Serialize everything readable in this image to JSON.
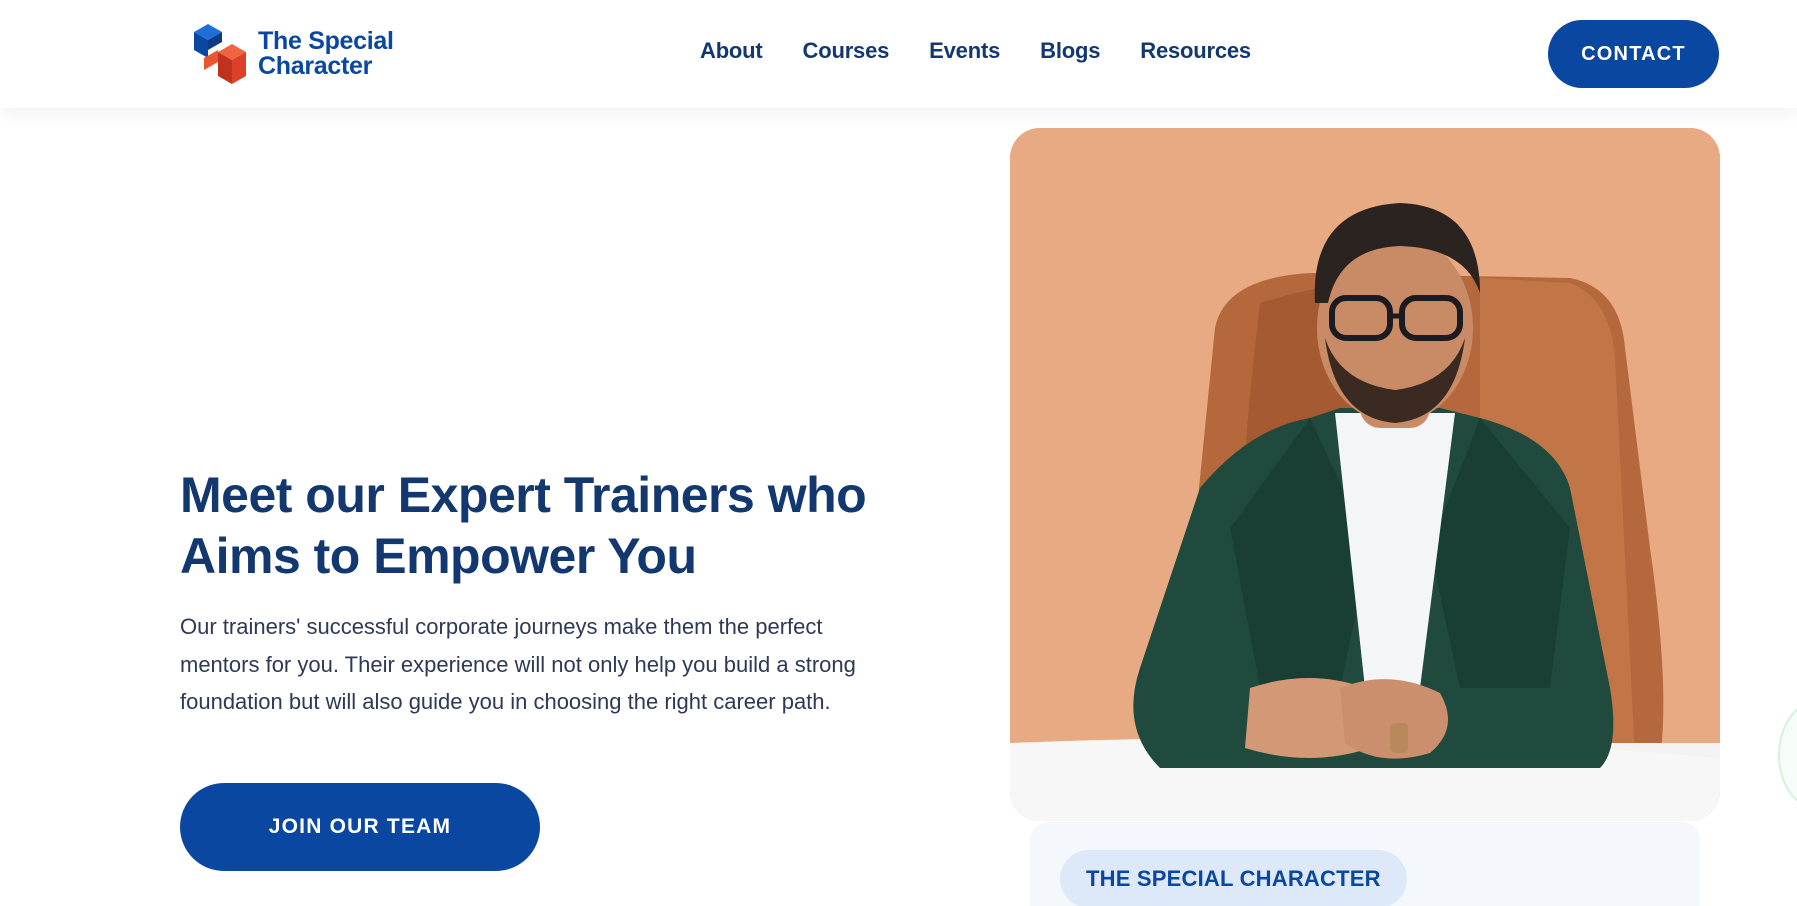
{
  "brand": {
    "name_line1": "The Special",
    "name_line2": "Character",
    "colors": {
      "primary": "#0a47a1",
      "logo_red": "#d9412b",
      "heading": "#13386f"
    }
  },
  "nav": {
    "items": [
      {
        "label": "About"
      },
      {
        "label": "Courses"
      },
      {
        "label": "Events"
      },
      {
        "label": "Blogs"
      },
      {
        "label": "Resources"
      }
    ],
    "contact_label": "CONTACT"
  },
  "hero": {
    "title": "Meet our Expert Trainers who Aims to Empower You",
    "description": "Our trainers' successful corporate journeys make them the perfect mentors for you. Their experience will not only help you build a strong foundation but will also guide you in choosing the right career path.",
    "cta_label": "JOIN OUR TEAM"
  },
  "trainer_card": {
    "badge": "THE SPECIAL CHARACTER"
  }
}
